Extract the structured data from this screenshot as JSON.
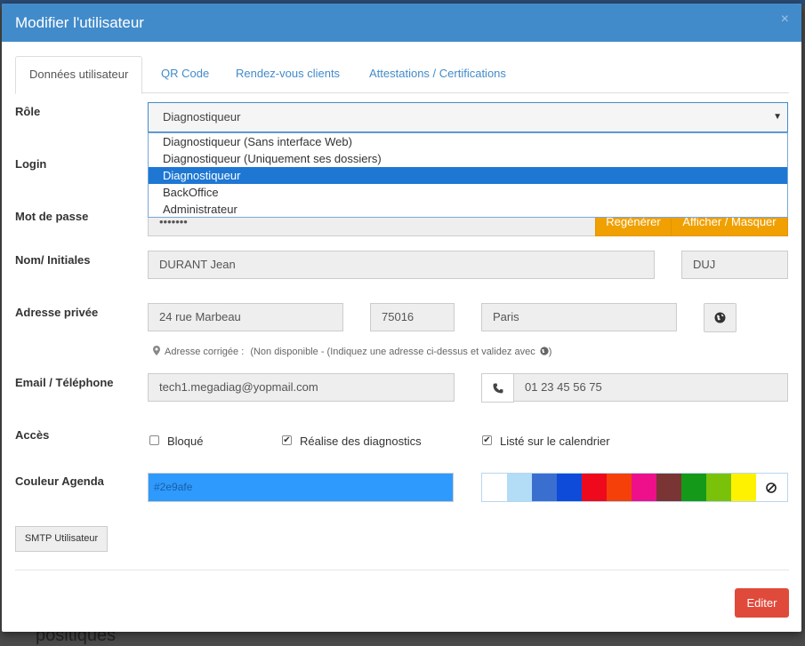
{
  "background": {
    "bottom_text": "positiques"
  },
  "modal": {
    "title": "Modifier l'utilisateur",
    "close": "×"
  },
  "tabs": [
    {
      "label": "Données utilisateur",
      "active": true
    },
    {
      "label": "QR Code",
      "active": false
    },
    {
      "label": "Rendez-vous clients",
      "active": false
    },
    {
      "label": "Attestations / Certifications",
      "active": false
    }
  ],
  "labels": {
    "role": "Rôle",
    "login": "Login",
    "password": "Mot de passe",
    "name": "Nom/ Initiales",
    "address": "Adresse privée",
    "email_phone": "Email / Téléphone",
    "access": "Accès",
    "calendar_color": "Couleur Agenda"
  },
  "role": {
    "selected": "Diagnostiqueur",
    "options": [
      "Diagnostiqueur (Sans interface Web)",
      "Diagnostiqueur (Uniquement ses dossiers)",
      "Diagnostiqueur",
      "BackOffice",
      "Administrateur"
    ],
    "highlighted_index": 2
  },
  "password": {
    "value": "•••••••",
    "regenerate_label": "Regénérer",
    "toggle_label": "Afficher / Masquer"
  },
  "name": {
    "full_name": "DURANT Jean",
    "initials": "DUJ"
  },
  "address": {
    "street": "24 rue Marbeau",
    "postcode": "75016",
    "city": "Paris",
    "hint_label": "Adresse corrigée :",
    "hint_text": "(Non disponible - (Indiquez une adresse ci-dessus et validez avec",
    "hint_end": ")"
  },
  "contact": {
    "email": "tech1.megadiag@yopmail.com",
    "phone": "01 23 45 56 75"
  },
  "access": {
    "blocked": {
      "label": "Bloqué",
      "checked": false
    },
    "does_diagnostics": {
      "label": "Réalise des diagnostics",
      "checked": true
    },
    "on_calendar": {
      "label": "Listé sur le calendrier",
      "checked": true
    }
  },
  "calendar_color": {
    "value": "#2e9afe",
    "palette": [
      "#ffffff",
      "#b3dcf7",
      "#3a6fcf",
      "#0d4bd8",
      "#ee0a1c",
      "#f5400a",
      "#ee108a",
      "#7b3434",
      "#149a18",
      "#7ac20a",
      "#fff200"
    ]
  },
  "buttons": {
    "smtp": "SMTP Utilisateur",
    "edit": "Editer"
  },
  "colors": {
    "header": "#428bca",
    "orange": "#f0a000",
    "danger": "#e04a3b"
  }
}
